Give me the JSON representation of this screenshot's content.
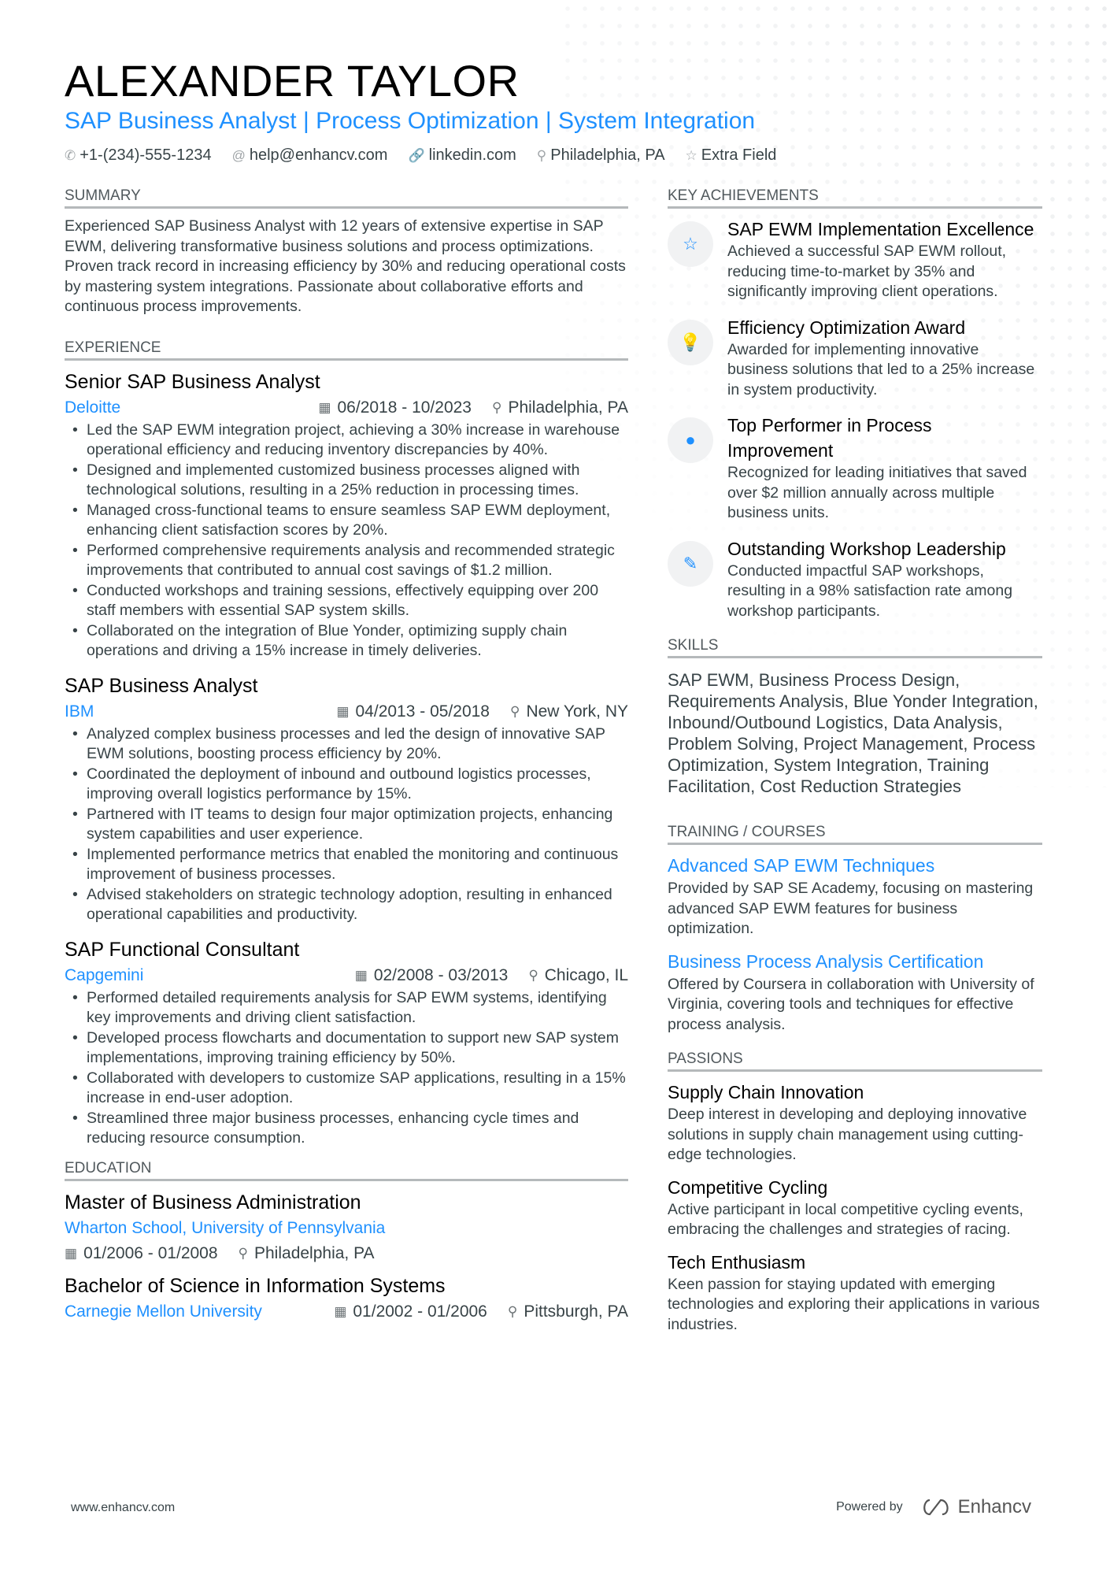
{
  "header": {
    "name": "ALEXANDER TAYLOR",
    "title": "SAP Business Analyst | Process Optimization | System Integration",
    "contacts": [
      {
        "icon": "phone-icon",
        "glyph": "✆",
        "text": "+1-(234)-555-1234"
      },
      {
        "icon": "at-icon",
        "glyph": "@",
        "text": "help@enhancv.com"
      },
      {
        "icon": "link-icon",
        "glyph": "🔗",
        "text": "linkedin.com"
      },
      {
        "icon": "location-icon",
        "glyph": "⚲",
        "text": "Philadelphia, PA"
      },
      {
        "icon": "star-icon",
        "glyph": "☆",
        "text": "Extra Field"
      }
    ]
  },
  "colors": {
    "accent": "#1e90ff",
    "text": "#384347",
    "heading": "#000000",
    "rule": "#b5b9bb"
  },
  "summary": {
    "heading": "Summary",
    "text": "Experienced SAP Business Analyst with 12 years of extensive expertise in SAP EWM, delivering transformative business solutions and process optimizations. Proven track record in increasing efficiency by 30% and reducing operational costs by mastering system integrations. Passionate about collaborative efforts and continuous process improvements."
  },
  "experience": {
    "heading": "Experience",
    "jobs": [
      {
        "title": "Senior SAP Business Analyst",
        "company": "Deloitte",
        "dates": "06/2018 - 10/2023",
        "location": "Philadelphia, PA",
        "bullets": [
          "Led the SAP EWM integration project, achieving a 30% increase in warehouse operational efficiency and reducing inventory discrepancies by 40%.",
          "Designed and implemented customized business processes aligned with technological solutions, resulting in a 25% reduction in processing times.",
          "Managed cross-functional teams to ensure seamless SAP EWM deployment, enhancing client satisfaction scores by 20%.",
          "Performed comprehensive requirements analysis and recommended strategic improvements that contributed to annual cost savings of $1.2 million.",
          "Conducted workshops and training sessions, effectively equipping over 200 staff members with essential SAP system skills.",
          "Collaborated on the integration of Blue Yonder, optimizing supply chain operations and driving a 15% increase in timely deliveries."
        ]
      },
      {
        "title": "SAP Business Analyst",
        "company": "IBM",
        "dates": "04/2013 - 05/2018",
        "location": "New York, NY",
        "bullets": [
          "Analyzed complex business processes and led the design of innovative SAP EWM solutions, boosting process efficiency by 20%.",
          "Coordinated the deployment of inbound and outbound logistics processes, improving overall logistics performance by 15%.",
          "Partnered with IT teams to design four major optimization projects, enhancing system capabilities and user experience.",
          "Implemented performance metrics that enabled the monitoring and continuous improvement of business processes.",
          "Advised stakeholders on strategic technology adoption, resulting in enhanced operational capabilities and productivity."
        ]
      },
      {
        "title": "SAP Functional Consultant",
        "company": "Capgemini",
        "dates": "02/2008 - 03/2013",
        "location": "Chicago, IL",
        "bullets": [
          "Performed detailed requirements analysis for SAP EWM systems, identifying key improvements and driving client satisfaction.",
          "Developed process flowcharts and documentation to support new SAP system implementations, improving training efficiency by 50%.",
          "Collaborated with developers to customize SAP applications, resulting in a 15% increase in end-user adoption.",
          "Streamlined three major business processes, enhancing cycle times and reducing resource consumption."
        ]
      }
    ]
  },
  "education": {
    "heading": "Education",
    "items": [
      {
        "degree": "Master of Business Administration",
        "school": "Wharton School, University of Pennsylvania",
        "dates": "01/2006 - 01/2008",
        "location": "Philadelphia, PA"
      },
      {
        "degree": "Bachelor of Science in Information Systems",
        "school": "Carnegie Mellon University",
        "dates": "01/2002 - 01/2006",
        "location": "Pittsburgh, PA"
      }
    ]
  },
  "achievements": {
    "heading": "Key Achievements",
    "items": [
      {
        "icon": "star-icon",
        "glyph": "☆",
        "title": "SAP EWM Implementation Excellence",
        "desc": "Achieved a successful SAP EWM rollout, reducing time-to-market by 35% and significantly improving client operations."
      },
      {
        "icon": "lightbulb-icon",
        "glyph": "💡",
        "title": "Efficiency Optimization Award",
        "desc": "Awarded for implementing innovative business solutions that led to a 25% increase in system productivity."
      },
      {
        "icon": "head-brain-icon",
        "glyph": "●",
        "title": "Top Performer in Process Improvement",
        "desc": "Recognized for leading initiatives that saved over $2 million annually across multiple business units."
      },
      {
        "icon": "magic-wand-icon",
        "glyph": "✎",
        "title": "Outstanding Workshop Leadership",
        "desc": "Conducted impactful SAP workshops, resulting in a 98% satisfaction rate among workshop participants."
      }
    ]
  },
  "skills": {
    "heading": "Skills",
    "text": "SAP EWM, Business Process Design, Requirements Analysis, Blue Yonder Integration, Inbound/Outbound Logistics, Data Analysis, Problem Solving, Project Management, Process Optimization, System Integration, Training Facilitation, Cost Reduction Strategies"
  },
  "training": {
    "heading": "Training / Courses",
    "items": [
      {
        "title": "Advanced SAP EWM Techniques",
        "desc": "Provided by SAP SE Academy, focusing on mastering advanced SAP EWM features for business optimization."
      },
      {
        "title": "Business Process Analysis Certification",
        "desc": "Offered by Coursera in collaboration with University of Virginia, covering tools and techniques for effective process analysis."
      }
    ]
  },
  "passions": {
    "heading": "Passions",
    "items": [
      {
        "title": "Supply Chain Innovation",
        "desc": "Deep interest in developing and deploying innovative solutions in supply chain management using cutting-edge technologies."
      },
      {
        "title": "Competitive Cycling",
        "desc": "Active participant in local competitive cycling events, embracing the challenges and strategies of racing."
      },
      {
        "title": "Tech Enthusiasm",
        "desc": "Keen passion for staying updated with emerging technologies and exploring their applications in various industries."
      }
    ]
  },
  "footer": {
    "website": "www.enhancv.com",
    "powered_by": "Powered by",
    "brand": "Enhancv"
  }
}
